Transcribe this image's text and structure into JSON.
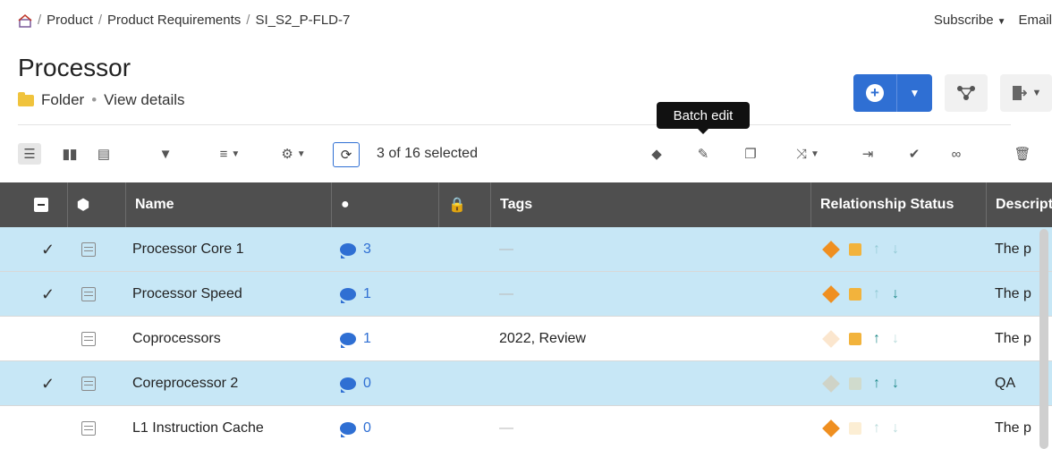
{
  "breadcrumb": [
    "Product",
    "Product Requirements",
    "SI_S2_P-FLD-7"
  ],
  "top_actions": {
    "subscribe": "Subscribe",
    "email": "Email"
  },
  "header": {
    "title": "Processor",
    "folder_label": "Folder",
    "view_details": "View details"
  },
  "tooltip": "Batch edit",
  "toolbar": {
    "selected_text": "3 of 16 selected"
  },
  "table": {
    "columns": [
      "Name",
      "Tags",
      "Relationship Status",
      "Descripti"
    ],
    "rows": [
      {
        "checked": true,
        "name": "Processor Core 1",
        "comments": "3",
        "tags": "—",
        "desc": "The p"
      },
      {
        "checked": true,
        "name": "Processor Speed",
        "comments": "1",
        "tags": "—",
        "desc": "The p"
      },
      {
        "checked": false,
        "name": "Coprocessors",
        "comments": "1",
        "tags": "2022, Review",
        "desc": "The p"
      },
      {
        "checked": true,
        "name": "Coreprocessor 2",
        "comments": "0",
        "tags": "",
        "desc": "QA"
      },
      {
        "checked": false,
        "name": "L1 Instruction Cache",
        "comments": "0",
        "tags": "—",
        "desc": "The p"
      }
    ]
  },
  "colors": {
    "accent": "#2f6fd3",
    "selected_row": "#c7e7f6",
    "header_bg": "#4f4f4f"
  }
}
